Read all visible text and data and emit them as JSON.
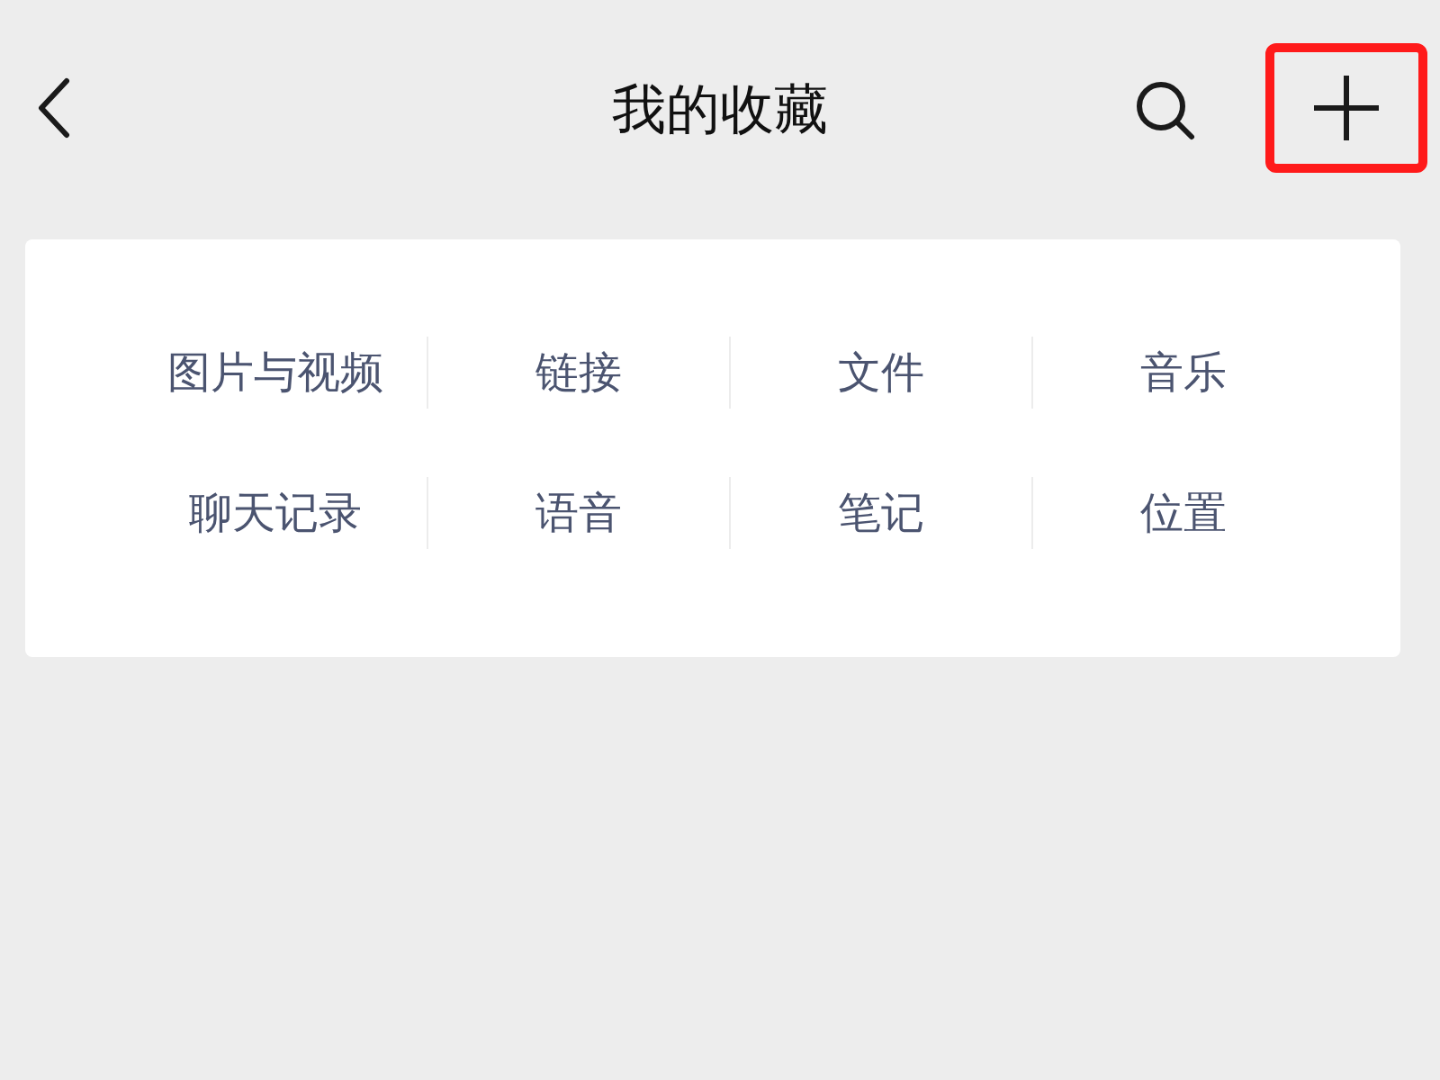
{
  "header": {
    "title": "我的收藏",
    "add_highlighted": true
  },
  "categories": [
    [
      {
        "label": "图片与视频"
      },
      {
        "label": "链接"
      },
      {
        "label": "文件"
      },
      {
        "label": "音乐"
      }
    ],
    [
      {
        "label": "聊天记录"
      },
      {
        "label": "语音"
      },
      {
        "label": "笔记"
      },
      {
        "label": "位置"
      }
    ]
  ]
}
